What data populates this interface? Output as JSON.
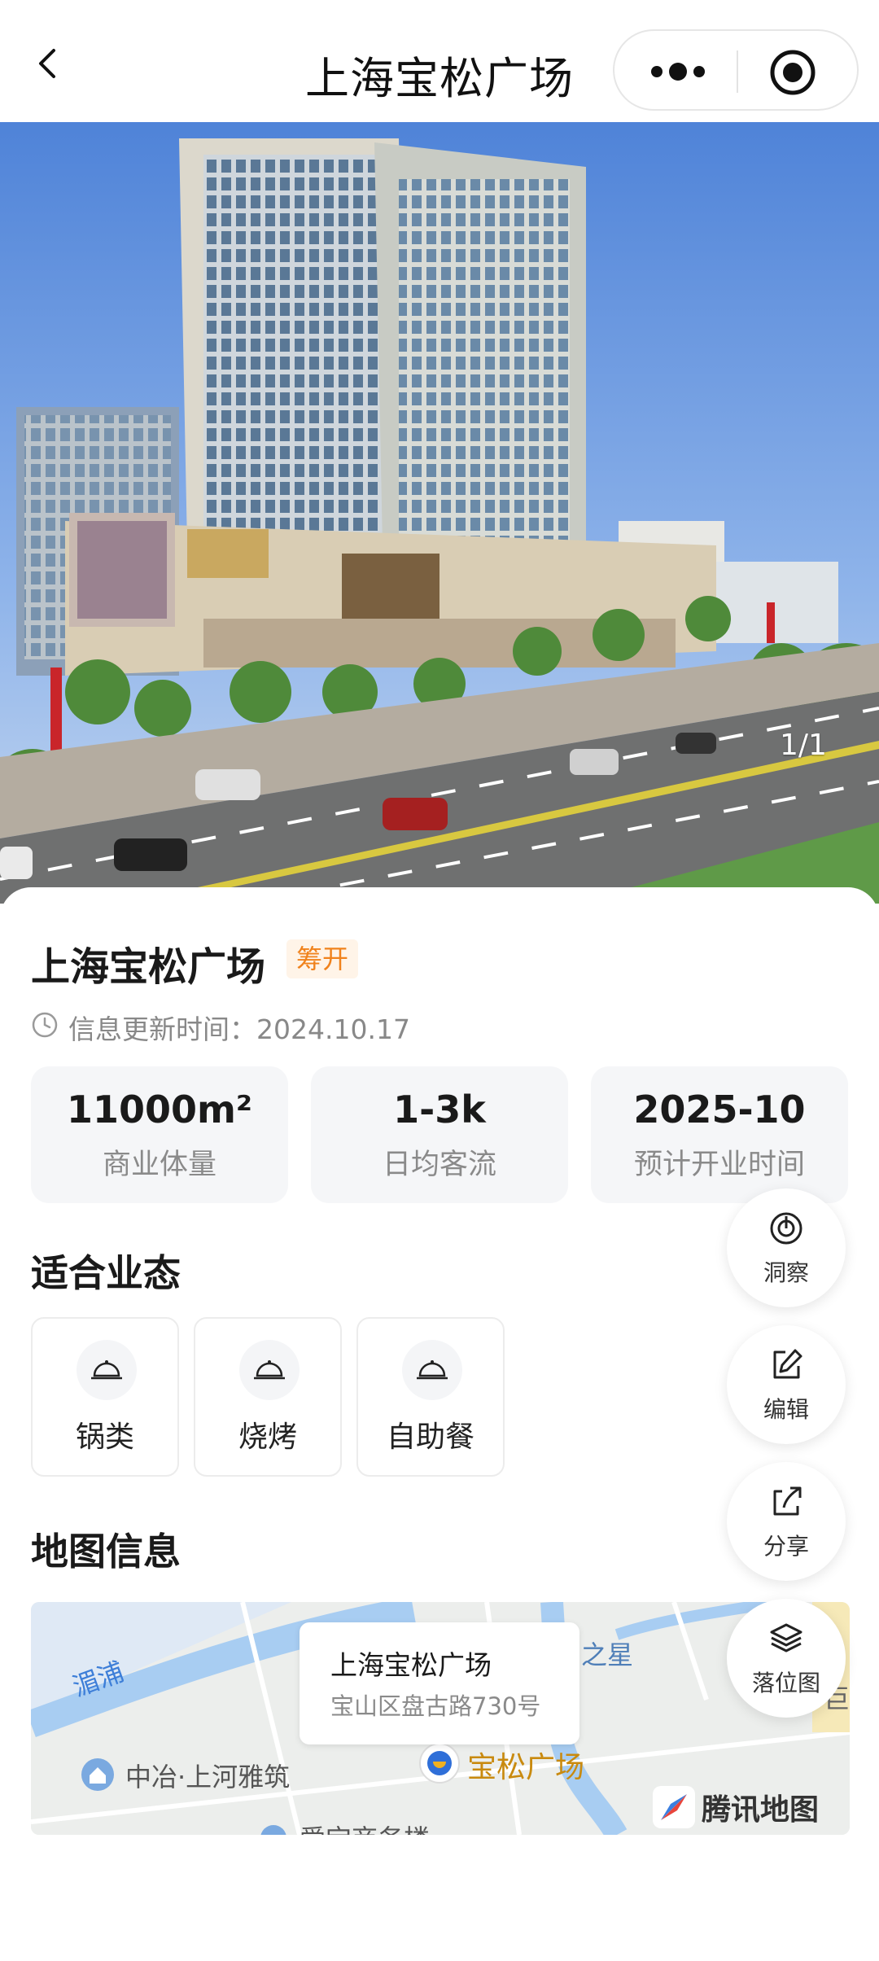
{
  "header": {
    "title": "上海宝松广场",
    "back_icon": "chevron-left-icon",
    "more_icon": "more-dots-icon",
    "close_icon": "target-circle-icon"
  },
  "hero": {
    "counter": "1/1",
    "image_description_icon": "building-photo"
  },
  "plaza": {
    "name": "上海宝松广场",
    "status": "筹开",
    "status_color": "#f0821c",
    "update_time": "信息更新时间：2024.10.17"
  },
  "stats": [
    {
      "value": "11000m²",
      "label": "商业体量"
    },
    {
      "value": "1-3k",
      "label": "日均客流"
    },
    {
      "value": "2025-10",
      "label": "预计开业时间"
    }
  ],
  "sections": {
    "business_title": "适合业态",
    "map_title": "地图信息"
  },
  "business_types": [
    {
      "label": "锅类",
      "icon": "food-cloche-icon"
    },
    {
      "label": "烧烤",
      "icon": "food-cloche-icon"
    },
    {
      "label": "自助餐",
      "icon": "food-cloche-icon"
    }
  ],
  "floating_actions": [
    {
      "label": "洞察",
      "icon": "insight-icon"
    },
    {
      "label": "编辑",
      "icon": "edit-icon"
    },
    {
      "label": "分享",
      "icon": "share-icon"
    },
    {
      "label": "落位图",
      "icon": "layers-icon"
    }
  ],
  "map": {
    "bubble_title": "上海宝松广场",
    "bubble_address": "宝山区盘古路730号",
    "labels": {
      "river": "湄浦",
      "community": "中冶·上河雅筑",
      "plaza": "宝松广场",
      "star": "之星",
      "partial": "巨",
      "bottom": "爱宝商务楼"
    },
    "logo": "腾讯地图"
  }
}
